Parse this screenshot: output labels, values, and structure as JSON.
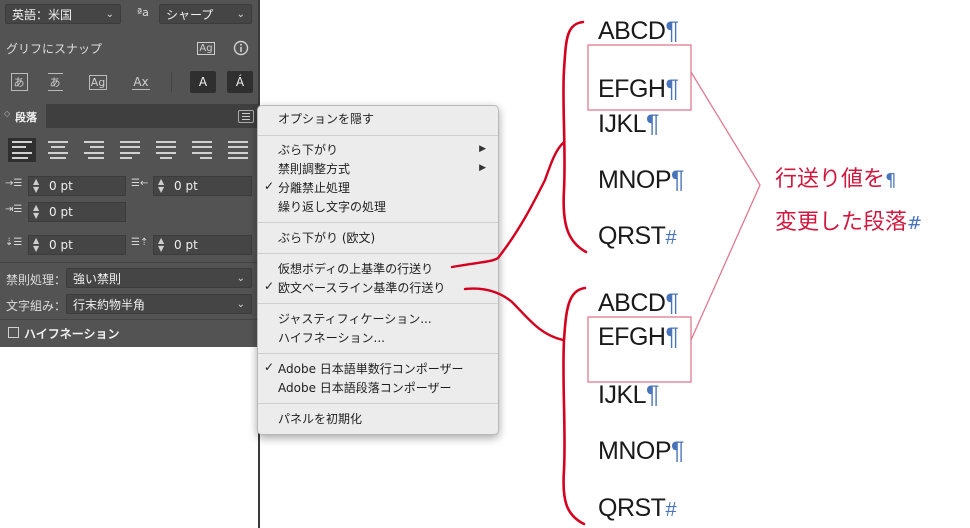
{
  "panel": {
    "language": "英語：米国",
    "antialias_icon": "ªa",
    "antialias": "シャープ",
    "snap_label": "グリフにスナップ",
    "snap_buttons": [
      "あ",
      "あ",
      "Ag",
      "Ax",
      "A",
      "Á"
    ],
    "paragraph_tab": "段落",
    "indent_left": "0 pt",
    "indent_right": "0 pt",
    "indent_first": "0 pt",
    "space_before": "0 pt",
    "space_after": "0 pt",
    "kinsoku_label": "禁則処理：",
    "kinsoku_value": "強い禁則",
    "mojikumi_label": "文字組み：",
    "mojikumi_value": "行末約物半角",
    "hyphenation_label": "ハイフネーション"
  },
  "menu": {
    "items": [
      {
        "label": "オプションを隠す"
      },
      {
        "label": "ぶら下がり",
        "submenu": true
      },
      {
        "label": "禁則調整方式",
        "submenu": true
      },
      {
        "label": "分離禁止処理",
        "checked": true
      },
      {
        "label": "繰り返し文字の処理"
      },
      {
        "label": "ぶら下がり (欧文)"
      },
      {
        "label": "仮想ボディの上基準の行送り"
      },
      {
        "label": "欧文ベースライン基準の行送り",
        "checked": true
      },
      {
        "label": "ジャスティフィケーション..."
      },
      {
        "label": "ハイフネーション..."
      },
      {
        "label": "Adobe 日本語単数行コンポーザー",
        "checked": true
      },
      {
        "label": "Adobe 日本語段落コンポーザー"
      },
      {
        "label": "パネルを初期化"
      }
    ],
    "check_mark": "✓",
    "submenu_arrow": "▶"
  },
  "samples": {
    "top": [
      "ABCD",
      "EFGH",
      "IJKL",
      "MNOP",
      "QRST"
    ],
    "bottom": [
      "ABCD",
      "EFGH",
      "IJKL",
      "MNOP",
      "QRST"
    ],
    "pilcrow": "¶",
    "end_mark": "#"
  },
  "annotation": {
    "line1": "行送り値を",
    "line2": "変更した段落",
    "pilcrow": "¶",
    "end_mark": "#",
    "color": "#d0183e"
  },
  "colors": {
    "panel_bg": "#535353",
    "menu_bg": "#ececec",
    "pilcrow": "#4a74b9",
    "highlight_box": "#e07a90",
    "stroke": "#d4001f"
  }
}
